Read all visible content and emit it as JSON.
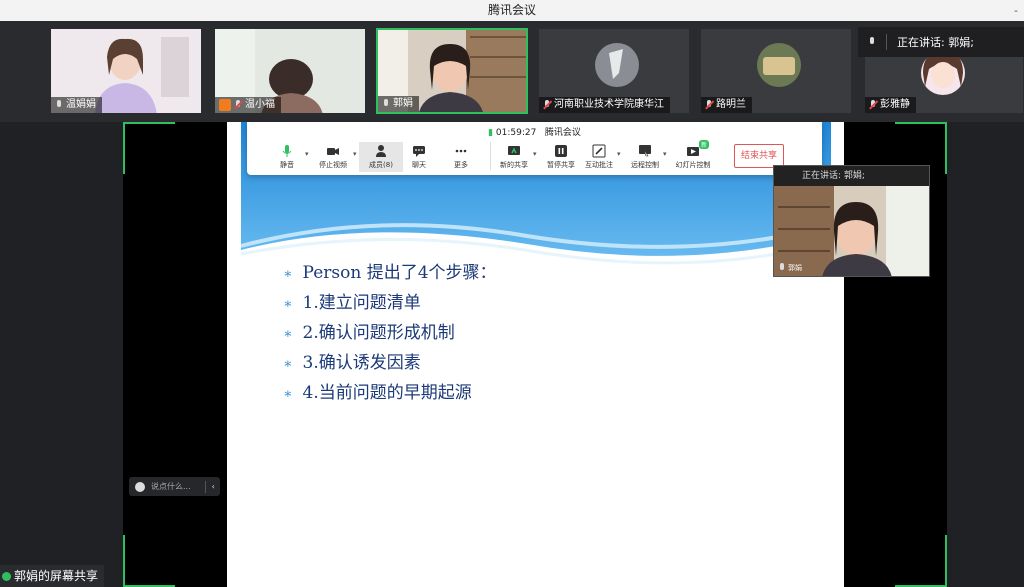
{
  "window": {
    "title": "腾讯会议",
    "control": "-"
  },
  "participants": [
    {
      "name": "温娟娟",
      "muted": false
    },
    {
      "name": "温小福",
      "muted": true
    },
    {
      "name": "郭娟",
      "muted": false
    },
    {
      "name": "河南职业技术学院康华江",
      "muted": true
    },
    {
      "name": "路明兰",
      "muted": true
    },
    {
      "name": "彭雅静",
      "muted": true
    }
  ],
  "speaking": {
    "label": "正在讲话: 郭娟;"
  },
  "toolbar": {
    "timer": "01:59:27",
    "meeting_name": "腾讯会议",
    "items": {
      "mute": "静音",
      "stop_video": "停止视频",
      "members": "成员(8)",
      "chat": "聊天",
      "more": "更多",
      "new_share": "新的共享",
      "pause_share": "暂停共享",
      "annotate": "互动批注",
      "remote_control": "远程控制",
      "slide_control": "幻灯片控制",
      "slide_badge": "新"
    },
    "end_share": "结束共享"
  },
  "self_view": {
    "header": "正在讲话: 郭娟;",
    "name": "郭娟"
  },
  "slide": {
    "bullets": [
      "Person 提出了4个步骤：",
      "1.建立问题清单",
      "2.确认问题形成机制",
      "3.确认诱发因素",
      "4.当前问题的早期起源"
    ]
  },
  "chat": {
    "placeholder": "说点什么..."
  },
  "share_label": "郭娟的屏幕共享",
  "colors": {
    "accent_green": "#2fbf5f",
    "end_red": "#e05555",
    "slide_text": "#1c3a78",
    "slide_blue": "#3a8fd6"
  }
}
